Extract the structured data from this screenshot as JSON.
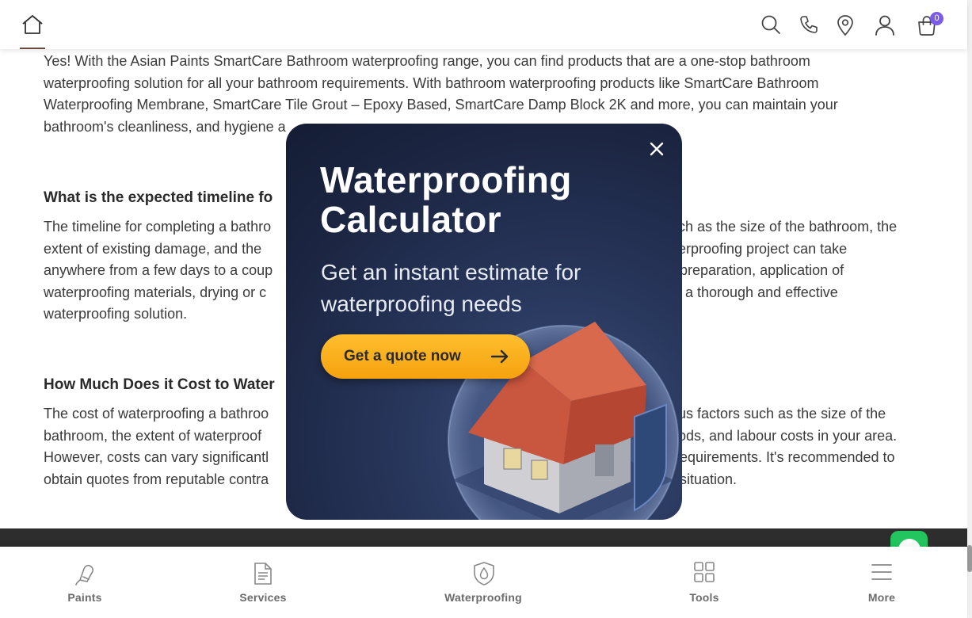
{
  "header": {
    "cart_count": "0",
    "icons": [
      "home-icon",
      "search-icon",
      "phone-icon",
      "location-icon",
      "user-icon",
      "cart-icon"
    ]
  },
  "article": {
    "para1_lines": [
      "Yes! With the Asian Paints SmartCare Bathroom waterproofing range, you can find products that are a one-stop bathroom",
      "waterproofing solution for all your bathroom requirements. With bathroom waterproofing products like SmartCare Bathroom",
      "Waterproofing Membrane, SmartCare Tile Grout – Epoxy Based, SmartCare Damp Block 2K and more, you can maintain your",
      "bathroom's cleanliness, and hygiene a"
    ],
    "q2": "What is the expected timeline fo",
    "para2_left": [
      "The timeline for completing a bathro",
      "extent of existing damage, and the",
      "anywhere from a few days to a coup",
      "waterproofing materials, drying or c",
      "waterproofing solution."
    ],
    "para2_right": [
      "ch as the size of the bathroom, the",
      "erproofing project can take",
      "preparation, application of",
      "a thorough and effective",
      ""
    ],
    "q3": "How Much Does it Cost to Water",
    "para3_left": [
      "The cost of waterproofing a bathroo",
      "bathroom, the extent of waterproof",
      "However, costs can vary significantl",
      "obtain quotes from reputable contra"
    ],
    "para3_right": [
      "us factors such as the size of the",
      "ods, and labour costs in your area.",
      "equirements. It's recommended to",
      "situation."
    ]
  },
  "modal": {
    "title_line1": "Waterproofing",
    "title_line2": "Calculator",
    "subtitle_line1": "Get an instant estimate for",
    "subtitle_line2": "waterproofing needs",
    "cta_label": "Get a quote now"
  },
  "bottom_nav": [
    {
      "label": "Paints",
      "icon": "paint-brush-icon"
    },
    {
      "label": "Services",
      "icon": "document-icon"
    },
    {
      "label": "Waterproofing",
      "icon": "shield-drop-icon"
    },
    {
      "label": "Tools",
      "icon": "grid-icon"
    },
    {
      "label": "More",
      "icon": "menu-icon"
    }
  ],
  "colors": {
    "accent": "#6b4a3f",
    "badge": "#7a5ce6",
    "cta": "#f5a20e",
    "modal_bg": "#1b2541",
    "footer_band": "#2d2d2d",
    "chat": "#22c55e"
  }
}
